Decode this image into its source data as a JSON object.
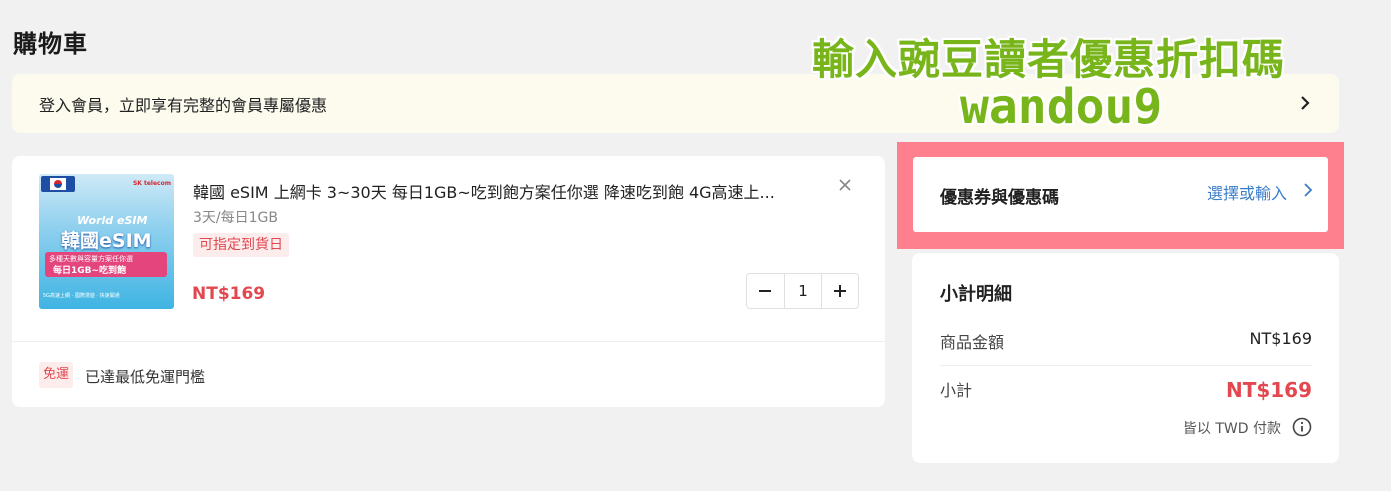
{
  "page": {
    "title": "購物車"
  },
  "login_banner": {
    "text": "登入會員，立即享有完整的會員專屬優惠"
  },
  "overlay": {
    "title": "輸入豌豆讀者優惠折扣碼",
    "code": "wandou9"
  },
  "cart_item": {
    "thumbnail": {
      "brand": "SK telecom",
      "world_label": "World eSIM",
      "name": "韓國eSIM",
      "band_line1": "多種天數與容量方案任你選",
      "band_line2": "每日1GB~吃到飽",
      "footer": "5G高速上網 · 國際漫遊 · 快速開通"
    },
    "title": "韓國 eSIM 上網卡 3~30天 每日1GB~吃到飽方案任你選 降速吃到飽 4G高速上...",
    "spec": "3天/每日1GB",
    "badge": "可指定到貨日",
    "price": "NT$169",
    "quantity": "1"
  },
  "shipping": {
    "badge": "免運",
    "text": "已達最低免運門檻"
  },
  "coupon": {
    "title": "優惠券與優惠碼",
    "action": "選擇或輸入"
  },
  "summary": {
    "title": "小計明細",
    "items_label": "商品金額",
    "items_value": "NT$169",
    "subtotal_label": "小計",
    "subtotal_value": "NT$169",
    "currency_note": "皆以 TWD 付款"
  },
  "colors": {
    "accent_red": "#e3474f",
    "link_blue": "#3a7dc9",
    "overlay_green": "#78b51a",
    "highlight_pink": "#fe7f8e"
  },
  "icons": [
    "chevron-right-icon",
    "close-icon",
    "minus-icon",
    "plus-icon",
    "info-icon"
  ]
}
